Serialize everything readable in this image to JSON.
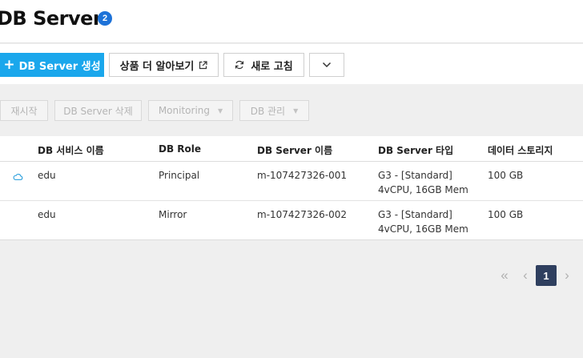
{
  "header": {
    "title": "DB Server",
    "count": "2"
  },
  "toolbar": {
    "create_label": "DB Server 생성",
    "learn_more_label": "상품 더 알아보기",
    "refresh_label": "새로 고침"
  },
  "actions": {
    "restart": "재시작",
    "delete": "DB Server 삭제",
    "monitoring": "Monitoring",
    "manage": "DB 관리"
  },
  "table": {
    "columns": [
      "DB 서비스 이름",
      "DB Role",
      "DB Server 이름",
      "DB Server 타입",
      "데이터 스토리지"
    ],
    "rows": [
      {
        "service": "edu",
        "role": "Principal",
        "server": "m-107427326-001",
        "type_line1": "G3 - [Standard]",
        "type_line2": "4vCPU, 16GB Mem",
        "storage": "100 GB"
      },
      {
        "service": "edu",
        "role": "Mirror",
        "server": "m-107427326-002",
        "type_line1": "G3 - [Standard]",
        "type_line2": "4vCPU, 16GB Mem",
        "storage": "100 GB"
      }
    ]
  },
  "pagination": {
    "current_page": "1",
    "first_symbol": "«",
    "prev_symbol": "‹",
    "next_symbol": "›"
  },
  "colors": {
    "primary": "#1aa7ec",
    "badge": "#1d72d8",
    "page_active": "#2f3f5f"
  },
  "icons": {
    "create": "plus-icon",
    "learn_more": "external-link-icon",
    "refresh": "refresh-icon",
    "more": "chevron-down-icon",
    "dropdown": "caret-down-icon",
    "row_status": "cloud-icon"
  }
}
